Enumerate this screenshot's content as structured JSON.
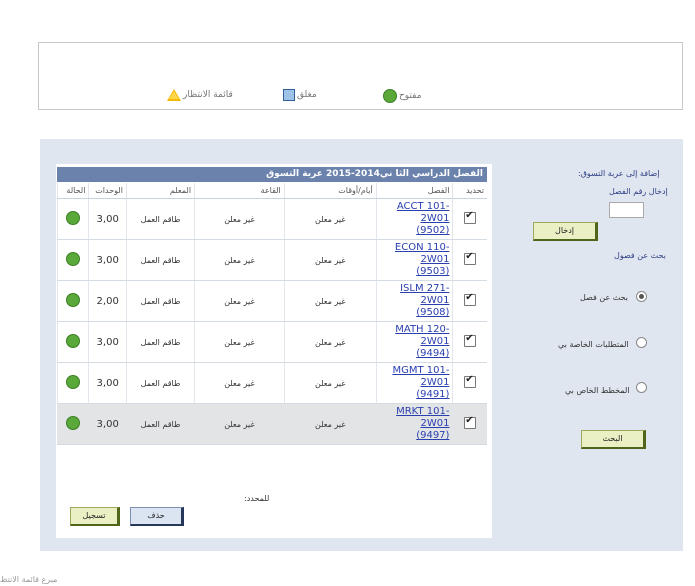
{
  "legend": {
    "open_label": "مفتوح",
    "closed_label": "مغلق",
    "waitlist_label": "قائمة الانتظار"
  },
  "cart": {
    "header": "الفصل الدراسي الثا ني2014-2015 عربة التسوق",
    "columns": [
      "تحديد",
      "الفصل",
      "أيام/أوقات",
      "القاعة",
      "المعلم",
      "الوحدات",
      "الحالة"
    ],
    "rows": [
      {
        "code": "ACCT 101-",
        "section": "2W01",
        "id": "(9502)",
        "days": "غير معلن",
        "room": "غير معلن",
        "instructor": "طاقم العمل",
        "units": "3,00",
        "checked": true
      },
      {
        "code": "ECON 110-",
        "section": "2W01",
        "id": "(9503)",
        "days": "غير معلن",
        "room": "غير معلن",
        "instructor": "طاقم العمل",
        "units": "3,00",
        "checked": true
      },
      {
        "code": "ISLM 271-",
        "section": "2W01",
        "id": "(9508)",
        "days": "غير معلن",
        "room": "غير معلن",
        "instructor": "طاقم العمل",
        "units": "2,00",
        "checked": true
      },
      {
        "code": "MATH 120-",
        "section": "2W01",
        "id": "(9494)",
        "days": "غير معلن",
        "room": "غير معلن",
        "instructor": "طاقم العمل",
        "units": "3,00",
        "checked": true
      },
      {
        "code": "MGMT 101-",
        "section": "2W01",
        "id": "(9491)",
        "days": "غير معلن",
        "room": "غير معلن",
        "instructor": "طاقم العمل",
        "units": "3,00",
        "checked": true
      },
      {
        "code": "MRKT 101-",
        "section": "2W01",
        "id": "(9497)",
        "days": "غير معلن",
        "room": "غير معلن",
        "instructor": "طاقم العمل",
        "units": "3,00",
        "checked": true
      }
    ],
    "selected_label": "للمحدد:",
    "delete_label": "حذف",
    "enroll_label": "تسجيل"
  },
  "sidebar": {
    "add_title": "إضافة إلى عربة التسوق:",
    "enter_class_label": "إدخال رقم الفصل",
    "enter_button": "إدخال",
    "search_title": "بحث عن فصول",
    "radio_search": "بحث عن فصل",
    "radio_requirements": "المتطلبات الخاصة بي",
    "radio_plan": "المخطط الخاص بي",
    "search_button": "البحث"
  },
  "footer": {
    "text": "مبرع قائمة الانتظ"
  },
  "colors": {
    "status_open": "#5aa83a",
    "header_bg": "#6b82ad",
    "panel_bg": "#dfe6ef"
  }
}
